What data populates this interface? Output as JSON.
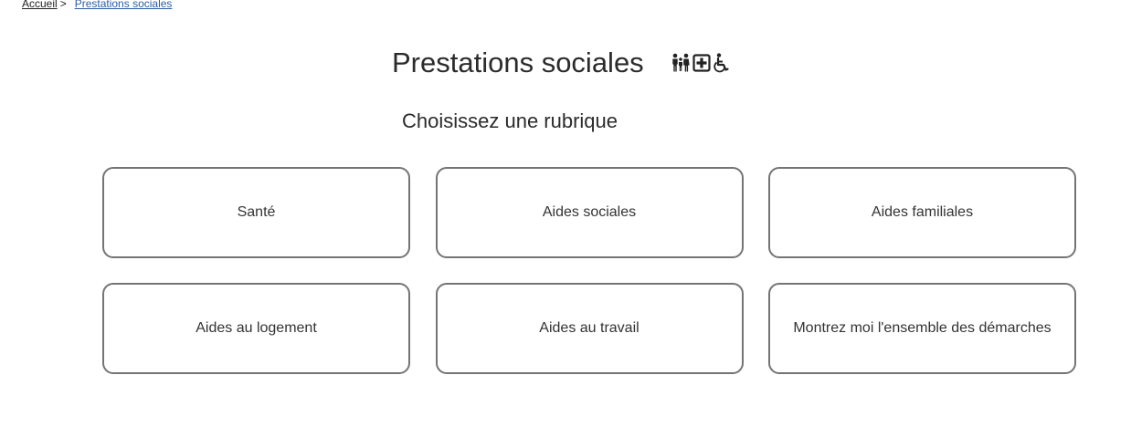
{
  "breadcrumb": {
    "home": "Accueil",
    "separator": ">",
    "current": "Prestations sociales"
  },
  "page": {
    "title": "Prestations sociales",
    "subtitle": "Choisissez une rubrique",
    "title_icons": [
      "family-icon",
      "medical-cross-icon",
      "wheelchair-icon"
    ]
  },
  "rubriques": [
    {
      "label": "Santé"
    },
    {
      "label": "Aides sociales"
    },
    {
      "label": "Aides familiales"
    },
    {
      "label": "Aides au logement"
    },
    {
      "label": "Aides au travail"
    },
    {
      "label": "Montrez moi l'ensemble des démarches"
    }
  ],
  "colors": {
    "link": "#2a5ea8",
    "tile_border": "#747474",
    "text": "#333333"
  }
}
